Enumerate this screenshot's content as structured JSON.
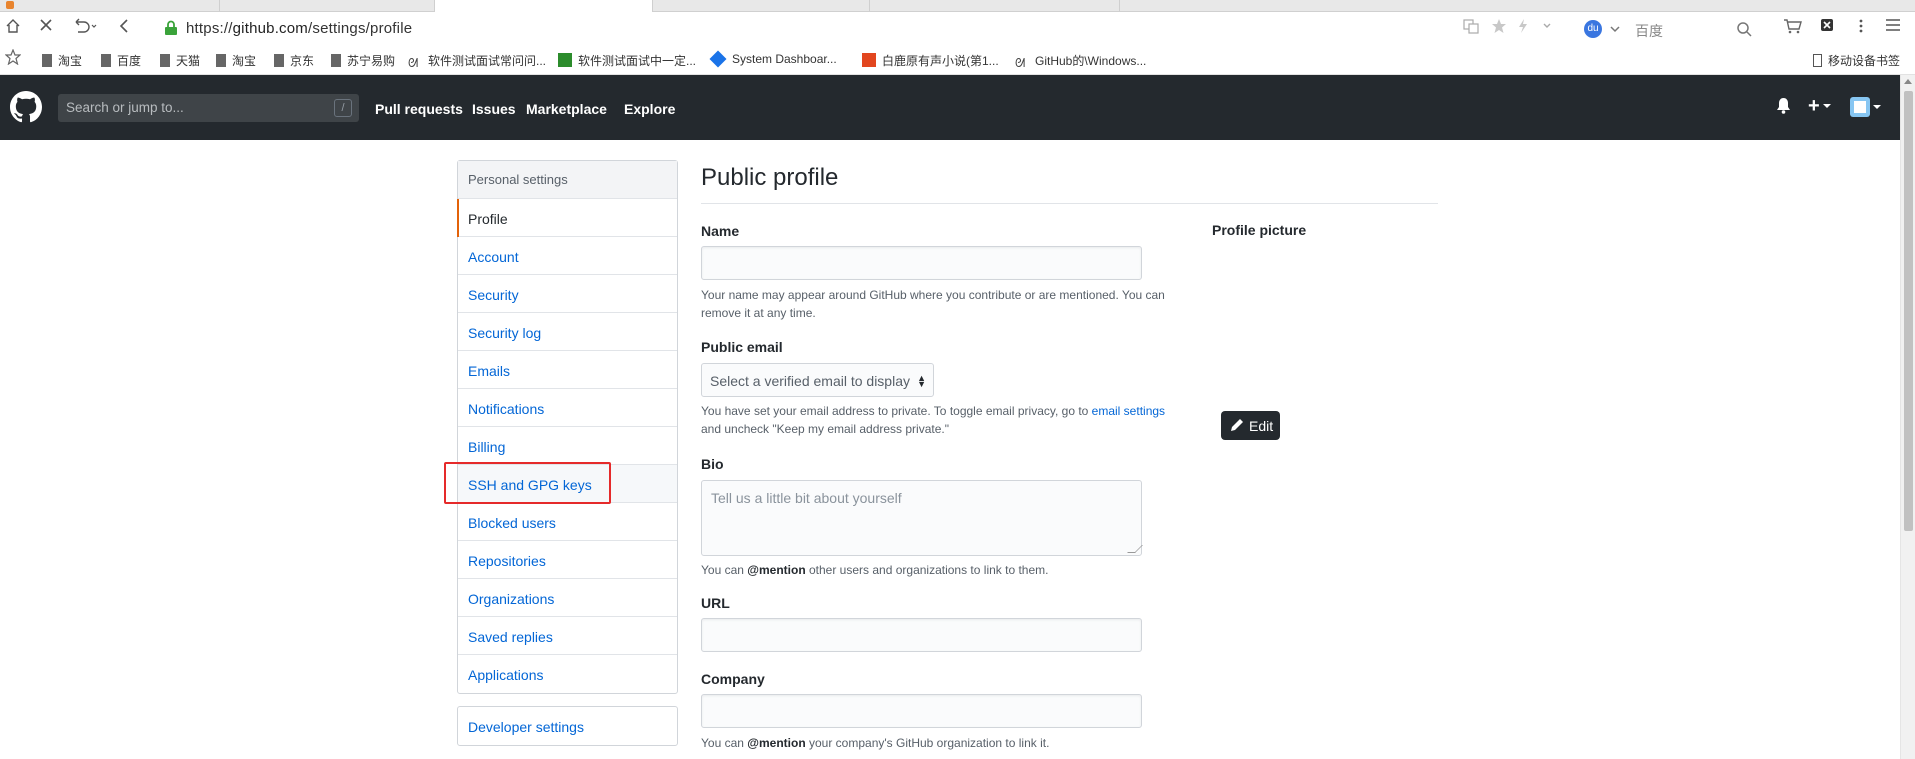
{
  "browser": {
    "url_prefix": "https://",
    "url_host": "github.com",
    "url_path": "/settings/profile",
    "search_engine": "百度",
    "bookmarks": [
      "淘宝",
      "百度",
      "天猫",
      "淘宝",
      "京东",
      "苏宁易购",
      "软件测试面试常问问...",
      "软件测试面试中一定...",
      "System Dashboar...",
      "白鹿原有声小说(第1...",
      "GitHub的\\Windows..."
    ],
    "mobile_bookmarks": "移动设备书签"
  },
  "header": {
    "search_placeholder": "Search or jump to...",
    "search_shortcut": "/",
    "nav": [
      "Pull requests",
      "Issues",
      "Marketplace",
      "Explore"
    ],
    "plus": "+"
  },
  "sidebar": {
    "heading": "Personal settings",
    "items": [
      {
        "label": "Profile",
        "selected": true
      },
      {
        "label": "Account"
      },
      {
        "label": "Security"
      },
      {
        "label": "Security log"
      },
      {
        "label": "Emails"
      },
      {
        "label": "Notifications"
      },
      {
        "label": "Billing"
      },
      {
        "label": "SSH and GPG keys",
        "highlighted": true
      },
      {
        "label": "Blocked users"
      },
      {
        "label": "Repositories"
      },
      {
        "label": "Organizations"
      },
      {
        "label": "Saved replies"
      },
      {
        "label": "Applications"
      }
    ],
    "developer_settings": "Developer settings"
  },
  "main": {
    "title": "Public profile",
    "name": {
      "label": "Name",
      "value": "",
      "note": "Your name may appear around GitHub where you contribute or are mentioned. You can remove it at any time."
    },
    "public_email": {
      "label": "Public email",
      "select_value": "Select a verified email to display",
      "note_before": "You have set your email address to private. To toggle email privacy, go to",
      "note_link": "email settings",
      "note_after": "and uncheck \"Keep my email address private.\""
    },
    "bio": {
      "label": "Bio",
      "placeholder": "Tell us a little bit about yourself",
      "note_before": "You can",
      "note_mention": "@mention",
      "note_after": "other users and organizations to link to them."
    },
    "url": {
      "label": "URL",
      "value": ""
    },
    "company": {
      "label": "Company",
      "value": "",
      "note_before": "You can",
      "note_mention": "@mention",
      "note_after": "your company's GitHub organization to link it."
    },
    "profile_picture": {
      "label": "Profile picture",
      "edit_label": "Edit"
    }
  },
  "colors": {
    "header_bg": "#24292e",
    "link": "#0366d6",
    "selected_marker": "#e36209",
    "annotation_box": "#e52a2a"
  }
}
